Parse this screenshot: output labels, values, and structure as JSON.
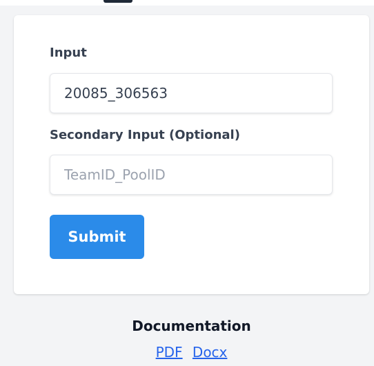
{
  "form": {
    "input_label": "Input",
    "input_value": "20085_306563",
    "secondary_label": "Secondary Input (Optional)",
    "secondary_placeholder": "TeamID_PoolID",
    "secondary_value": "",
    "submit_label": "Submit"
  },
  "documentation": {
    "title": "Documentation",
    "links": [
      {
        "label": "PDF"
      },
      {
        "label": "Docx"
      }
    ]
  },
  "colors": {
    "page_background": "#f3f4f6",
    "card_background": "#ffffff",
    "button_accent": "#2b8be9",
    "link_color": "#2563eb"
  }
}
